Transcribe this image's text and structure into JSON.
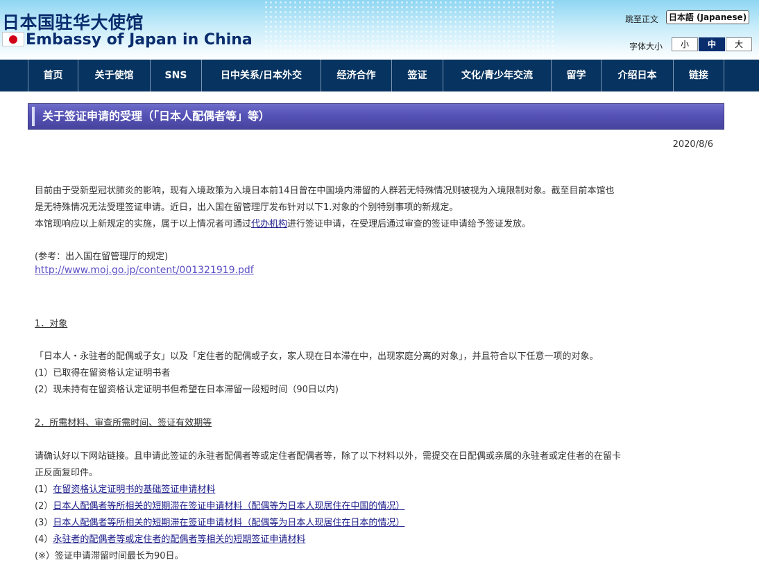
{
  "header": {
    "title_cn": "日本国驻华大使馆",
    "title_en": "Embassy of Japan in China",
    "skip_link": "跳至正文",
    "language_button": "日本語 (Japanese)",
    "font_size_label": "字体大小",
    "font_sizes": [
      "小",
      "中",
      "大"
    ],
    "font_size_selected": "中"
  },
  "nav": {
    "items": [
      "首页",
      "关于使馆",
      "SNS",
      "日中关系/日本外交",
      "经济合作",
      "签证",
      "文化/青少年交流",
      "留学",
      "介绍日本",
      "链接"
    ]
  },
  "page": {
    "title": "关于签证申请的受理（「日本人配偶者等」等）",
    "date": "2020/8/6",
    "intro": {
      "line1": "目前由于受新型冠状肺炎的影响，现有入境政策为入境日本前14日曾在中国境内滞留的人群若无特殊情况则被视为入境限制对象。截至目前本馆也",
      "line2": "是无特殊情况无法受理签证申请。近日，出入国在留管理厅发布针对以下1.对象的个别特别事项的新规定。",
      "line3_before": "本馆现响应以上新规定的实施，属于以上情况者可通过",
      "line3_link": "代办机构",
      "line3_after": "进行签证申请，在受理后通过审查的签证申请给予签证发放。"
    },
    "reference": {
      "label": "(参考：出入国在留管理厅的规定)",
      "url": "http://www.moj.go.jp/content/001321919.pdf"
    },
    "section1": {
      "heading": "1．对象",
      "text": "「日本人・永驻者的配偶或子女」以及「定住者的配偶或子女，家人现在日本滞在中，出现家庭分离的对象」，并且符合以下任意一项的对象。",
      "items": [
        "(1）已取得在留资格认定证明书者",
        "(2）现未持有在留资格认定证明书但希望在日本滞留一段短时间（90日以内)"
      ]
    },
    "section2": {
      "heading": "2．所需材料、审查所需时间、签证有效期等",
      "text1": "请确认好以下网站链接。且申请此签证的永驻者配偶者等或定住者配偶者等，除了以下材料以外，需提交在日配偶或亲属的永驻者或定住者的在留卡",
      "text2": "正反面复印件。",
      "links": [
        {
          "prefix": "(1）",
          "label": "在留资格认定证明书的基础签证申请材料"
        },
        {
          "prefix": "(2）",
          "label": "日本人配偶者等所相关的短期滞在签证申请材料（配偶等为日本人现居住在中国的情况）"
        },
        {
          "prefix": "(3）",
          "label": "日本人配偶者等所相关的短期滞在签证申请材料（配偶等为日本人现居住在日本的情况）"
        },
        {
          "prefix": "(4）",
          "label": "永驻者的配偶者等或定住者的配偶者等相关的短期签证申请材料"
        }
      ],
      "note": "(※）签证申请滞留时间最长为90日。"
    }
  }
}
